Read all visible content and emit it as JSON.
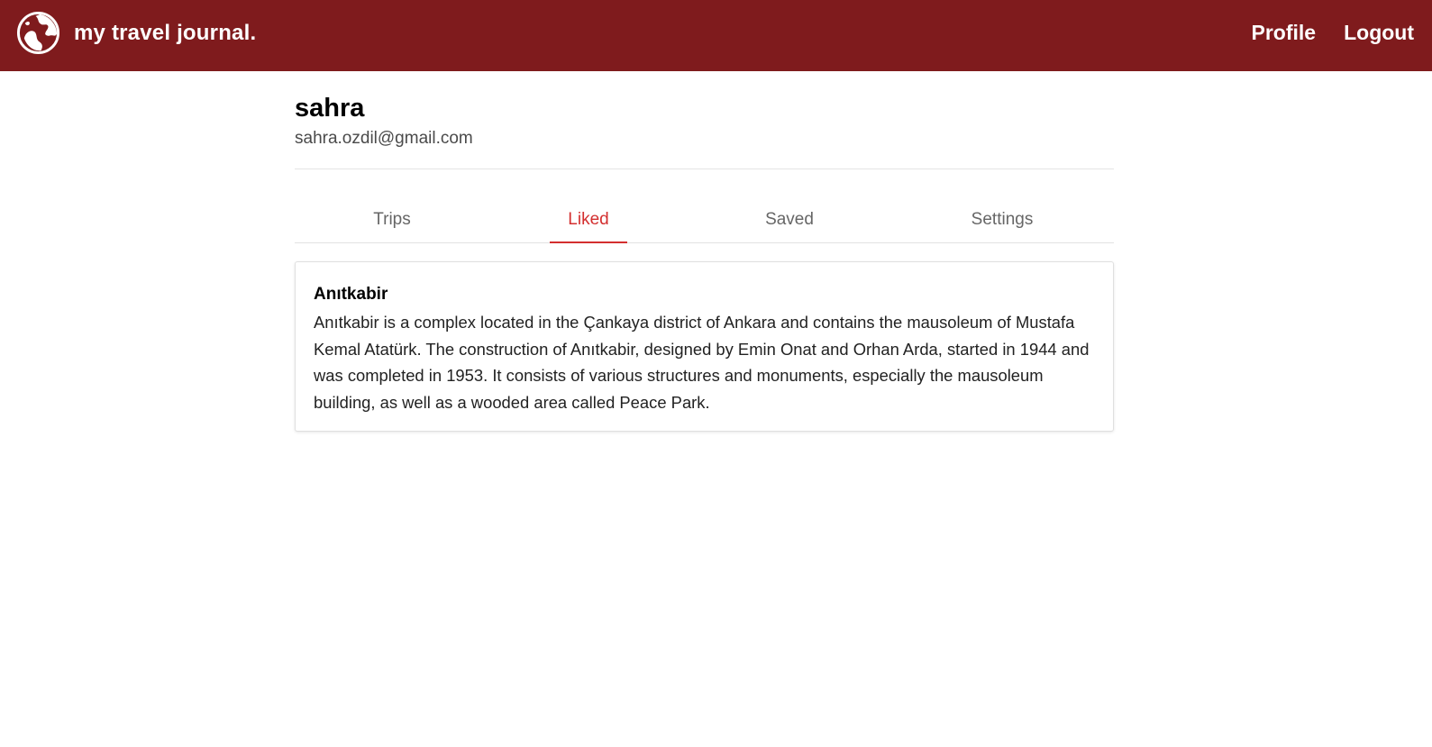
{
  "header": {
    "brand_text": "my travel journal.",
    "logo_icon": "globe-icon",
    "nav": [
      {
        "label": "Profile"
      },
      {
        "label": "Logout"
      }
    ],
    "background_color": "#7f1b1d"
  },
  "profile": {
    "name": "sahra",
    "email": "sahra.ozdil@gmail.com"
  },
  "tabs": [
    {
      "label": "Trips",
      "active": false
    },
    {
      "label": "Liked",
      "active": true
    },
    {
      "label": "Saved",
      "active": false
    },
    {
      "label": "Settings",
      "active": false
    }
  ],
  "accent_color": "#d32f2f",
  "liked_items": [
    {
      "title": "Anıtkabir",
      "description": "Anıtkabir is a complex located in the Çankaya district of Ankara and contains the mausoleum of Mustafa Kemal Atatürk. The construction of Anıtkabir, designed by Emin Onat and Orhan Arda, started in 1944 and was completed in 1953. It consists of various structures and monuments, especially the mausoleum building, as well as a wooded area called Peace Park."
    }
  ]
}
